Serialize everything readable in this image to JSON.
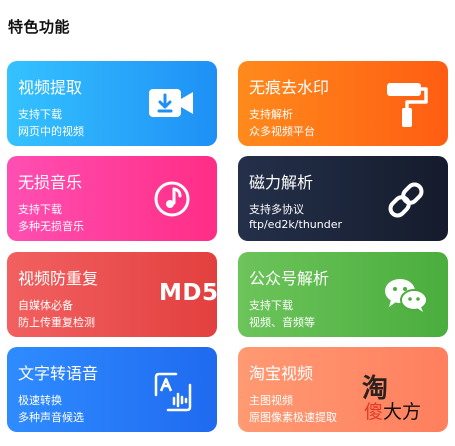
{
  "section": {
    "title": "特色功能"
  },
  "cards": [
    {
      "title": "视频提取",
      "line1": "支持下载",
      "line2": "网页中的视频",
      "icon": "video-download-icon"
    },
    {
      "title": "无痕去水印",
      "line1": "支持解析",
      "line2": "众多视频平台",
      "icon": "paint-roller-icon"
    },
    {
      "title": "无损音乐",
      "line1": "支持下载",
      "line2": "多种无损音乐",
      "icon": "music-note-icon"
    },
    {
      "title": "磁力解析",
      "line1": "支持多协议",
      "line2": "ftp/ed2k/thunder",
      "icon": "link-icon"
    },
    {
      "title": "视频防重复",
      "line1": "自媒体必备",
      "line2": "防上传重复检测",
      "icon": "md5-icon",
      "badge": "MD5"
    },
    {
      "title": "公众号解析",
      "line1": "支持下载",
      "line2": "视频、音频等",
      "icon": "wechat-icon"
    },
    {
      "title": "文字转语音",
      "line1": "极速转换",
      "line2": "多种声音候选",
      "icon": "text-to-speech-icon"
    },
    {
      "title": "淘宝视频",
      "line1": "主图视频",
      "line2": "原图像素极速提取",
      "icon": "taobao-icon"
    }
  ],
  "watermark": {
    "big": "淘",
    "text_first": "傻",
    "text_rest": "大方"
  },
  "colors": {
    "card1": "#1e90f5",
    "card2": "#ff5d12",
    "card3": "#ff2d86",
    "card4": "#151b2c",
    "card5": "#e2403f",
    "card6": "#4bad3e",
    "card7": "#1f6af0",
    "card8": "#ff7f5e"
  }
}
